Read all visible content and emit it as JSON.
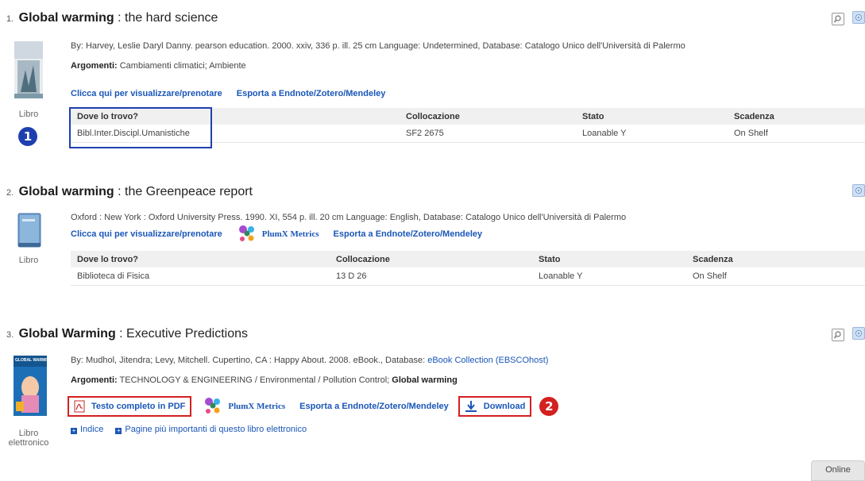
{
  "results": [
    {
      "num": "1.",
      "title_main": "Global warming",
      "title_rest": " : the hard science",
      "meta": "By: Harvey, Leslie Daryl Danny. pearson education. 2000. xxiv, 336 p. ill. 25 cm Language: Undetermined, Database: Catalogo Unico dell'Università di Palermo",
      "argomenti_label": "Argomenti:",
      "argomenti": " Cambiamenti climatici; Ambiente",
      "link_view": "Clicca qui per visualizzare/prenotare",
      "link_export": "Esporta a Endnote/Zotero/Mendeley",
      "format": "Libro",
      "holdings_headers": [
        "Dove lo trovo?",
        "Collocazione",
        "Stato",
        "Scadenza"
      ],
      "holdings_row": [
        "Bibl.Inter.Discipl.Umanistiche",
        "SF2 2675",
        "Loanable Y",
        "On Shelf"
      ]
    },
    {
      "num": "2.",
      "title_main": "Global warming",
      "title_rest": " : the Greenpeace report",
      "meta": "Oxford : New York : Oxford University Press. 1990. XI, 554 p. ill. 20 cm Language: English, Database: Catalogo Unico dell'Università di Palermo",
      "link_view": "Clicca qui per visualizzare/prenotare",
      "plumx": "PlumX Metrics",
      "link_export": "Esporta a Endnote/Zotero/Mendeley",
      "format": "Libro",
      "holdings_headers": [
        "Dove lo trovo?",
        "Collocazione",
        "Stato",
        "Scadenza"
      ],
      "holdings_row": [
        "Biblioteca di Fisica",
        "13 D 26",
        "Loanable Y",
        "On Shelf"
      ]
    },
    {
      "num": "3.",
      "title_main": "Global Warming",
      "title_rest": " : Executive Predictions",
      "meta_prefix": "By: Mudhol, Jitendra; Levy, Mitchell. Cupertino, CA : Happy About. 2008. eBook., Database: ",
      "meta_link": "eBook Collection (EBSCOhost)",
      "argomenti_label": "Argomenti:",
      "argomenti": " TECHNOLOGY & ENGINEERING / Environmental / Pollution Control; ",
      "argomenti_bold": "Global warming",
      "link_pdf": "Testo completo in PDF",
      "plumx": "PlumX Metrics",
      "link_export": "Esporta a Endnote/Zotero/Mendeley",
      "link_download": "Download",
      "sub_index": "Indice",
      "sub_pages": "Pagine più importanti di questo libro elettronico",
      "format_line1": "Libro",
      "format_line2": "elettronico",
      "cover_text": "GLOBAL WARMING"
    }
  ],
  "markers": {
    "one": "1",
    "two": "2"
  },
  "online_tab": "Online",
  "colors": {
    "link": "#1a56b8",
    "marker_blue": "#1f3fb0",
    "marker_red": "#d42020",
    "hilite_blue": "#1f3fb0",
    "hilite_red": "#d42020"
  }
}
